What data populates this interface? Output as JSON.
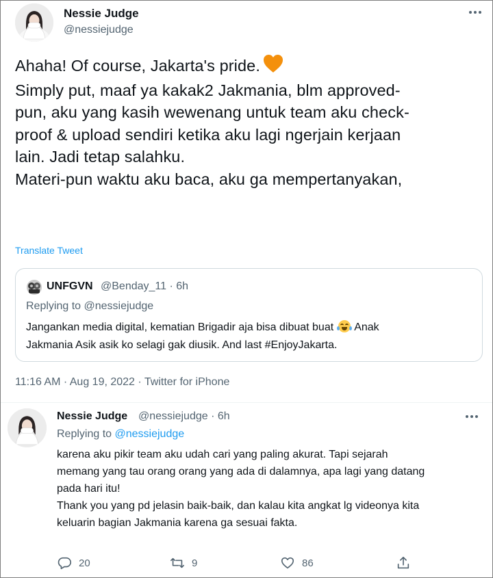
{
  "main_tweet": {
    "author_name": "Nessie Judge",
    "author_handle": "@nessiejudge",
    "lines": [
      "Ahaha! Of course, Jakarta's pride.",
      "",
      "Simply put, maaf ya kakak2 Jakmania, blm approved-",
      "pun, aku yang kasih wewenang untuk team aku check-",
      "proof & upload sendiri ketika aku lagi ngerjain kerjaan",
      "lain. Jadi tetap salahku.",
      "",
      "Materi-pun waktu aku baca, aku ga mempertanyakan,"
    ],
    "emoji": "orange-heart",
    "translate_label": "Translate Tweet",
    "timestamp": "11:16 AM · Aug 19, 2022 · Twitter for iPhone"
  },
  "quote": {
    "author_name": "UNFGVN",
    "meta": "@Benday_11 · 6h",
    "replying_to": "Replying to @nessiejudge",
    "body_part1": "Jangankan media digital, kematian Brigadir aja bisa dibuat buat",
    "emoji": "face-with-tears-of-joy",
    "body_part2": " Anak",
    "body_line2": "Jakmania Asik asik ko selagi gak diusik. And last #EnjoyJakarta."
  },
  "reply": {
    "author_name": "Nessie Judge",
    "meta": "@nessiejudge · 6h",
    "replying_prefix": "Replying to ",
    "replying_handle": "@nessiejudge",
    "lines": [
      "karena aku pikir team aku udah cari yang paling akurat. Tapi sejarah",
      "memang yang tau orang orang yang ada di dalamnya, apa lagi yang datang",
      "pada hari itu!",
      "",
      "Thank you yang pd jelasin baik-baik, dan kalau kita angkat lg videonya kita",
      "keluarin bagian Jakmania karena ga sesuai fakta."
    ],
    "actions": {
      "reply_count": "20",
      "retweet_count": "9",
      "like_count": "86"
    }
  },
  "colors": {
    "text": "#0f1419",
    "secondary": "#536471",
    "link": "#1d9bf0",
    "heart": "#f4900c"
  }
}
